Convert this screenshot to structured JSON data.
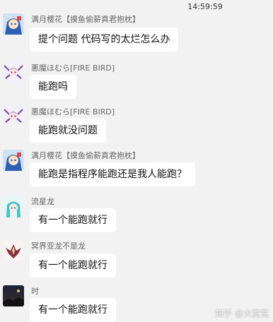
{
  "timestamp": "14:59:59",
  "messages": [
    {
      "sender": "满月樱花【摸鱼偷薪真君抱枕】",
      "text": "提个问题 代码写的太烂怎么办",
      "avatar": "anime-girl-blue-avatar"
    },
    {
      "sender": "悪魔ほむら[FIRE BIRD]",
      "text": "能跑吗",
      "avatar": "anime-girl-purple-avatar"
    },
    {
      "sender": "悪魔ほむら[FIRE BIRD]",
      "text": "能跑就没问题",
      "avatar": "anime-girl-purple-avatar"
    },
    {
      "sender": "满月樱花【摸鱼偷薪真君抱枕】",
      "text": "能跑是指程序能跑还是我人能跑？",
      "avatar": "anime-girl-blue-avatar"
    },
    {
      "sender": "流星龙",
      "text": "有一个能跑就行",
      "avatar": "teal-hair-girl-avatar"
    },
    {
      "sender": "冥界亚龙不是龙",
      "text": "有一个能跑就行",
      "avatar": "dragon-sprite-avatar"
    },
    {
      "sender": "时",
      "text": "有一个能跑就行",
      "avatar": "dark-night-avatar"
    }
  ],
  "watermark": "知乎 @大宽宽",
  "colors": {
    "background": "#f2f2f2",
    "bubble": "#ffffff"
  }
}
